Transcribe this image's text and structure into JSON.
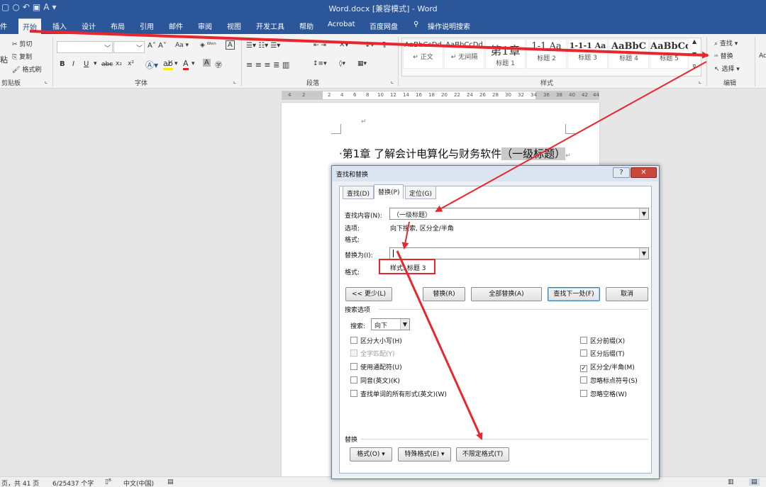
{
  "titlebar": {
    "qat_icons": [
      "save-icon",
      "undo-icon",
      "redo-icon",
      "font-icon",
      "customize-icon"
    ],
    "title": "Word.docx [兼容模式]  -  Word"
  },
  "menu": {
    "file_partial": "件",
    "tabs": [
      "开始",
      "插入",
      "设计",
      "布局",
      "引用",
      "邮件",
      "审阅",
      "视图",
      "开发工具",
      "帮助",
      "Acrobat",
      "百度网盘"
    ],
    "active": "开始",
    "tell_me": "操作说明搜索"
  },
  "ribbon": {
    "clipboard": {
      "paste_partial": "粘",
      "cut": "剪切",
      "copy": "复制",
      "format_painter": "格式刷",
      "label": "剪贴板"
    },
    "font": {
      "label": "字体",
      "bold": "B",
      "italic": "I",
      "underline": "U",
      "strike": "abc",
      "sub": "x₂",
      "sup": "x²"
    },
    "paragraph": {
      "label": "段落"
    },
    "styles": {
      "label": "样式",
      "items": [
        {
          "preview": "AaBbCcDd",
          "name": "↵ 正文"
        },
        {
          "preview": "AaBbCcDd",
          "name": "↵ 无间隔"
        },
        {
          "preview": "第1章",
          "name": "标题 1"
        },
        {
          "preview": "1-1 Aa",
          "name": "标题 2"
        },
        {
          "preview": "1-1-1 Aa",
          "name": "标题 3"
        },
        {
          "preview": "AaBbC",
          "name": "标题 4"
        },
        {
          "preview": "AaBbCc",
          "name": "标题 5"
        }
      ]
    },
    "editing": {
      "find": "查找",
      "replace": "替换",
      "select": "选择",
      "label": "编辑"
    }
  },
  "ruler": {
    "ticks": [
      "4",
      "2",
      "2",
      "4",
      "6",
      "8",
      "10",
      "12",
      "14",
      "16",
      "18",
      "20",
      "22",
      "24",
      "26",
      "28",
      "30",
      "32",
      "34",
      "36",
      "38",
      "40",
      "42",
      "44"
    ]
  },
  "document": {
    "heading_main": "·第1章  了解会计电算化与财务软件",
    "heading_marked": "（一级标题）",
    "para_mark": "↵"
  },
  "dialog": {
    "title": "查找和替换",
    "help": "?",
    "close": "✕",
    "tabs": [
      "查找(D)",
      "替换(P)",
      "定位(G)"
    ],
    "active_tab": "替换(P)",
    "find_label": "查找内容(N):",
    "find_value": "（一级标题）",
    "options_label": "选项:",
    "options_value": "向下搜索, 区分全/半角",
    "find_format_label": "格式:",
    "replace_label": "替换为(I):",
    "replace_value": "",
    "replace_format_label": "格式:",
    "replace_format_value": "样式: 标题 3",
    "buttons": {
      "less": "<< 更少(L)",
      "replace": "替换(R)",
      "replace_all": "全部替换(A)",
      "find_next": "查找下一处(F)",
      "cancel": "取消"
    },
    "search_options_label": "搜索选项",
    "search_label": "搜索:",
    "search_direction": "向下",
    "left_checks": [
      {
        "label": "区分大小写(H)",
        "checked": false,
        "disabled": false
      },
      {
        "label": "全字匹配(Y)",
        "checked": false,
        "disabled": true
      },
      {
        "label": "使用通配符(U)",
        "checked": false,
        "disabled": false
      },
      {
        "label": "同音(英文)(K)",
        "checked": false,
        "disabled": false
      },
      {
        "label": "查找单词的所有形式(英文)(W)",
        "checked": false,
        "disabled": false
      }
    ],
    "right_checks": [
      {
        "label": "区分前缀(X)",
        "checked": false
      },
      {
        "label": "区分后缀(T)",
        "checked": false
      },
      {
        "label": "区分全/半角(M)",
        "checked": true
      },
      {
        "label": "忽略标点符号(S)",
        "checked": false
      },
      {
        "label": "忽略空格(W)",
        "checked": false
      }
    ],
    "replace_section_label": "替换",
    "bottom_buttons": {
      "format": "格式(O) ▾",
      "special": "特殊格式(E) ▾",
      "no_format": "不限定格式(T)"
    }
  },
  "statusbar": {
    "page": "页，共 41 页",
    "words": "6/25437 个字",
    "lang": "中文(中国)"
  },
  "colors": {
    "accent": "#2b579a",
    "annotation": "#e8262e"
  }
}
